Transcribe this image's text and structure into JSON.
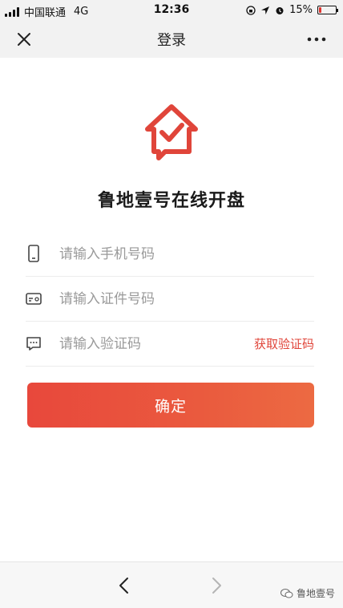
{
  "status_bar": {
    "carrier": "中国联通",
    "network": "4G",
    "time": "12:36",
    "battery": "15%",
    "battery_level": 0.15
  },
  "nav": {
    "title": "登录"
  },
  "app": {
    "title": "鲁地壹号在线开盘",
    "brand_color": "#e0453a"
  },
  "form": {
    "phone_placeholder": "请输入手机号码",
    "id_placeholder": "请输入证件号码",
    "code_placeholder": "请输入验证码",
    "get_code_label": "获取验证码",
    "confirm_label": "确定"
  },
  "watermark": {
    "text": "鲁地壹号"
  }
}
